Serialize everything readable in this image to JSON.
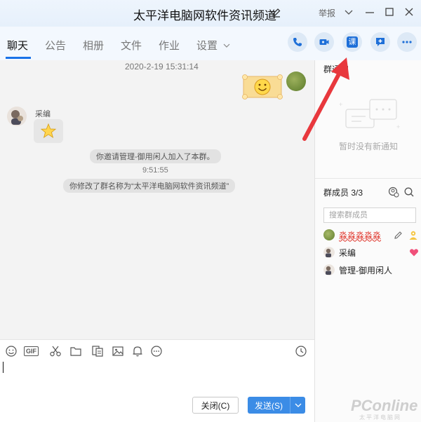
{
  "window": {
    "title": "太平洋电脑网软件资讯频道",
    "report": "举报"
  },
  "tabs": [
    {
      "label": "聊天",
      "active": true
    },
    {
      "label": "公告",
      "active": false
    },
    {
      "label": "相册",
      "active": false
    },
    {
      "label": "文件",
      "active": false
    },
    {
      "label": "作业",
      "active": false
    },
    {
      "label": "设置",
      "active": false
    }
  ],
  "toolbar_buttons": [
    {
      "icon": "phone-icon"
    },
    {
      "icon": "video-icon"
    },
    {
      "icon": "class-icon",
      "label": "课"
    },
    {
      "icon": "add-app-icon"
    },
    {
      "icon": "more-icon"
    }
  ],
  "chat": {
    "timestamp1": "2020-2-19 15:31:14",
    "sender_name": "采编",
    "system_msg1": "你邀请管理-御用闲人加入了本群。",
    "timestamp2": "9:51:55",
    "system_msg2": "你修改了群名称为“太平洋电脑网软件资讯频道”"
  },
  "input_tools": [
    "emoji-icon",
    "gif-icon",
    "scissors-icon",
    "folder-icon",
    "document-icon",
    "image-icon",
    "bell-icon",
    "more-circle-icon",
    "clock-icon"
  ],
  "gif_label": "GIF",
  "buttons": {
    "close": "关闭(C)",
    "send": "发送(S)"
  },
  "sidebar": {
    "notice_title": "群通知",
    "notice_empty": "暂时没有新通知",
    "members_title": "群成员 3/3",
    "search_placeholder": "搜索群成员",
    "members": [
      {
        "name": "淼淼淼淼淼",
        "highlight": true
      },
      {
        "name": "采编",
        "highlight": false
      },
      {
        "name": "管理-御用闲人",
        "highlight": false
      }
    ]
  },
  "watermark": {
    "brand": "PConline",
    "sub": "太平洋电脑网"
  },
  "colors": {
    "accent": "#1a73e8",
    "send_button": "#3b8ce6",
    "annotation_arrow": "#e8383d",
    "heart": "#f0507a"
  }
}
